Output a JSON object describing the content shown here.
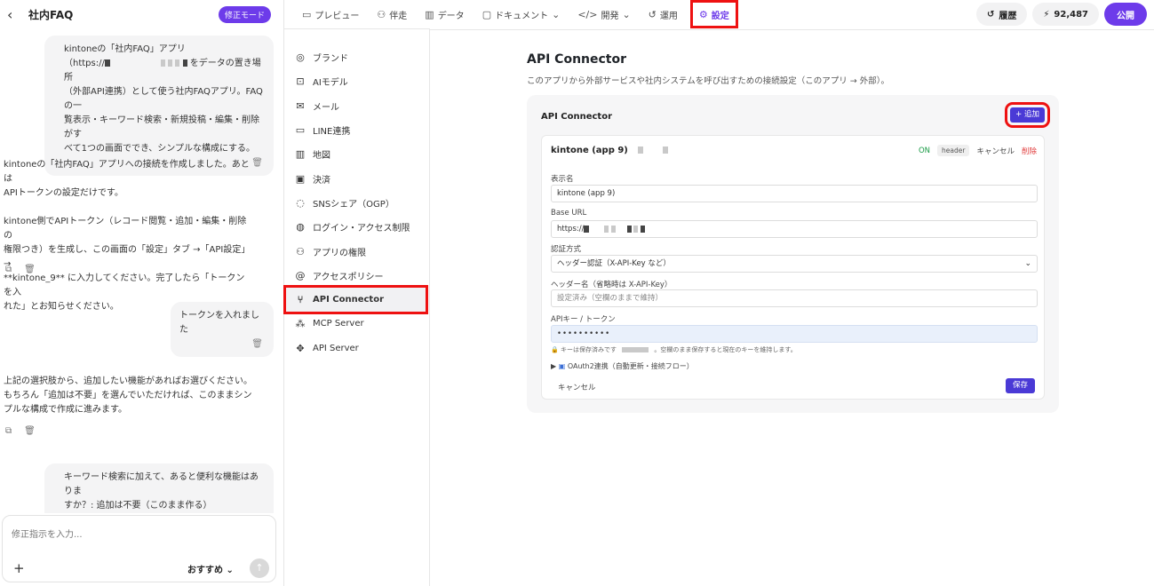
{
  "app": {
    "project_title": "社内FAQ",
    "mode_badge": "修正モード"
  },
  "toolbar": {
    "items": [
      {
        "label": "プレビュー",
        "icon": "monitor-icon"
      },
      {
        "label": "伴走",
        "icon": "robot-icon"
      },
      {
        "label": "データ",
        "icon": "bar-chart-icon"
      },
      {
        "label": "ドキュメント",
        "icon": "book-icon"
      },
      {
        "label": "開発",
        "icon": "code-icon"
      },
      {
        "label": "運用",
        "icon": "history-icon"
      },
      {
        "label": "設定",
        "icon": "gear-icon"
      }
    ],
    "history_label": "履歴",
    "credits": "92,487",
    "publish_label": "公開"
  },
  "chat": {
    "msg1_line1": "kintoneの「社内FAQ」アプリ",
    "msg1_line2a": "（https://",
    "msg1_line2b": "をデータの置き場所",
    "msg1_line3": "（外部API連携）として使う社内FAQアプリ。FAQの一",
    "msg1_line4": "覧表示・キーワード検索・新規投稿・編集・削除がす",
    "msg1_line5": "べて1つの画面ででき、シンプルな構成にする。",
    "bot1_p1a": "kintoneの「社内FAQ」アプリへの接続を作成しました。あとは",
    "bot1_p1b": "APIトークンの設定だけです。",
    "bot1_p2a": "kintone側でAPIトークン（レコード閲覧・追加・編集・削除の",
    "bot1_p2b": "権限つき）を生成し、この画面の「設定」タブ →「API設定」→",
    "bot1_p2c": "**kintone_9** に入力してください。完了したら「トークンを入",
    "bot1_p2d": "れた」とお知らせください。",
    "msg2": "トークンを入れました",
    "bot2_a": "上記の選択肢から、追加したい機能があればお選びください。",
    "bot2_b": "もちろん「追加は不要」を選んでいただければ、このままシン",
    "bot2_c": "プルな構成で作成に進みます。",
    "msg3_a": "キーワード検索に加えて、あると便利な機能はありま",
    "msg3_b": "すか？: 追加は不要（このまま作る）",
    "input_placeholder": "修正指示を入力...",
    "recommend_label": "おすすめ"
  },
  "menu": {
    "items": [
      {
        "label": "ブランド",
        "icon": "palette-icon"
      },
      {
        "label": "AIモデル",
        "icon": "chip-icon"
      },
      {
        "label": "メール",
        "icon": "mail-icon"
      },
      {
        "label": "LINE連携",
        "icon": "chat-icon"
      },
      {
        "label": "地図",
        "icon": "map-icon"
      },
      {
        "label": "決済",
        "icon": "wallet-icon"
      },
      {
        "label": "SNSシェア（OGP）",
        "icon": "share-icon"
      },
      {
        "label": "ログイン・アクセス制限",
        "icon": "globe-lock-icon"
      },
      {
        "label": "アプリの権限",
        "icon": "users-icon"
      },
      {
        "label": "アクセスポリシー",
        "icon": "at-icon"
      },
      {
        "label": "API Connector",
        "icon": "plug-icon"
      },
      {
        "label": "MCP Server",
        "icon": "network-icon"
      },
      {
        "label": "API Server",
        "icon": "server-icon"
      }
    ]
  },
  "main": {
    "title": "API Connector",
    "subtitle": "このアプリから外部サービスや社内システムを呼び出すための接続設定（このアプリ → 外部）。",
    "card_title": "API Connector",
    "add_label": "+ 追加",
    "connector": {
      "name": "kintone (app 9)",
      "status": "ON",
      "auth_tag": "header",
      "cancel_label": "キャンセル",
      "delete_label": "削除",
      "display_name_label": "表示名",
      "display_name_value": "kintone (app 9)",
      "base_url_label": "Base URL",
      "base_url_value": "https://",
      "auth_method_label": "認証方式",
      "auth_method_value": "ヘッダー認証（X-API-Key など）",
      "header_name_label": "ヘッダー名（省略時は X-API-Key）",
      "header_name_placeholder": "設定済み（空欄のままで維持）",
      "api_key_label": "APIキー / トークン",
      "api_key_value": "••••••••••",
      "hint_a": "🔒 キーは保存済みです",
      "hint_b": "。空欄のまま保存すると現在のキーを維持します。",
      "oauth_label": "OAuth2連携（自動更新・接続フロー）",
      "cancel_bottom": "キャンセル",
      "save_label": "保存"
    }
  }
}
